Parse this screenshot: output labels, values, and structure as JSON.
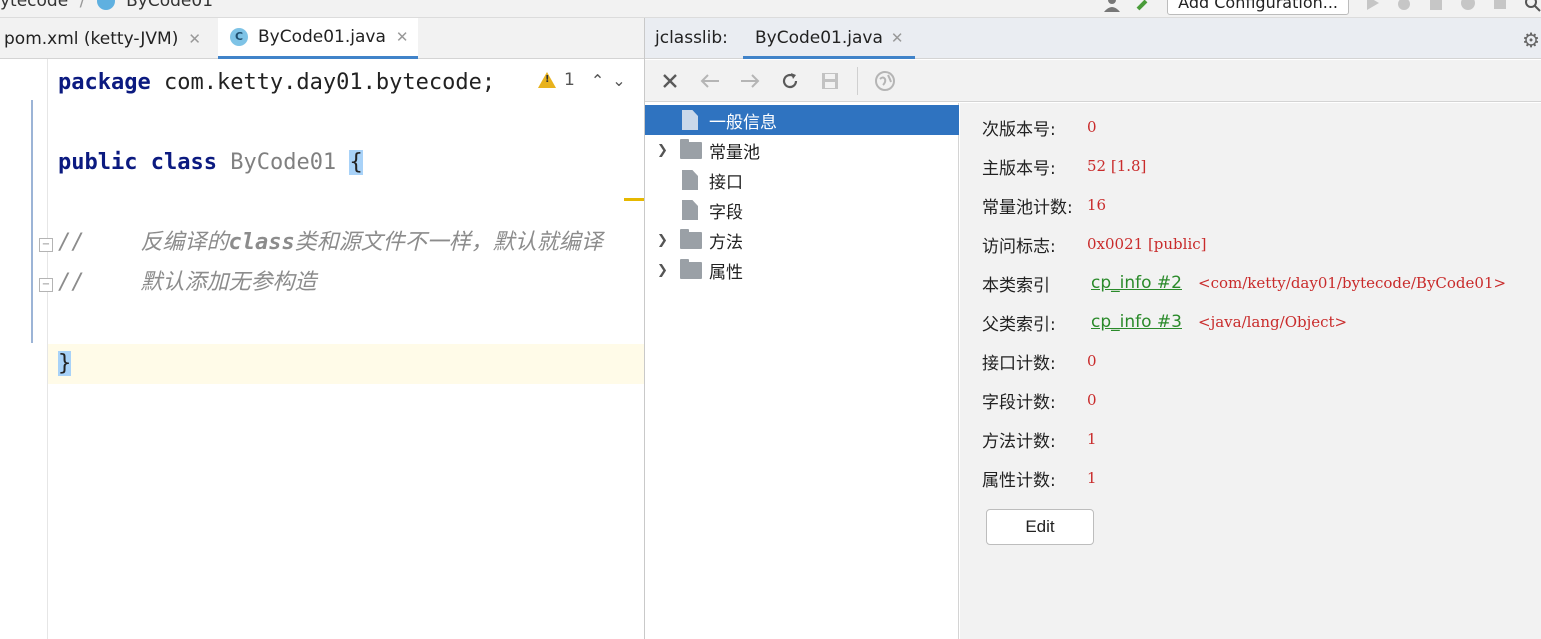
{
  "topbar": {
    "breadcrumb_left": "ytecode",
    "breadcrumb_right": "ByCode01",
    "add_configuration": "Add Configuration..."
  },
  "editor": {
    "tabs": [
      {
        "label": "pom.xml (ketty-JVM)",
        "active": false
      },
      {
        "label": "ByCode01.java",
        "active": true
      }
    ],
    "warning_count": "1",
    "code": {
      "package_kw": "package",
      "package_name": "com.ketty.day01.bytecode;",
      "public_kw": "public",
      "class_kw": "class",
      "class_name": "ByCode01",
      "open_brace": "{",
      "comment1_slashes": "//",
      "comment1_text_a": "反编译的",
      "comment1_text_b": "class",
      "comment1_text_c": "类和源文件不一样，默认就编译",
      "comment2_slashes": "//",
      "comment2_text": "默认添加无参构造",
      "close_brace": "}"
    }
  },
  "jclasslib": {
    "title": "jclasslib:",
    "tab": "ByCode01.java",
    "toolbar": [
      "close-icon",
      "back-icon",
      "forward-icon",
      "refresh-icon",
      "save-icon",
      "browser-icon"
    ],
    "tree": [
      {
        "label": "一般信息",
        "type": "file",
        "expandable": false,
        "selected": true
      },
      {
        "label": "常量池",
        "type": "folder",
        "expandable": true,
        "selected": false
      },
      {
        "label": "接口",
        "type": "file",
        "expandable": false,
        "selected": false
      },
      {
        "label": "字段",
        "type": "file",
        "expandable": false,
        "selected": false
      },
      {
        "label": "方法",
        "type": "folder",
        "expandable": true,
        "selected": false
      },
      {
        "label": "属性",
        "type": "folder",
        "expandable": true,
        "selected": false
      }
    ],
    "details": [
      {
        "label": "次版本号:",
        "value": "0"
      },
      {
        "label": "主版本号:",
        "value": "52 [1.8]"
      },
      {
        "label": "常量池计数:",
        "value": "16"
      },
      {
        "label": "访问标志:",
        "value": "0x0021 [public]"
      },
      {
        "label": "本类索引",
        "link": "cp_info #2",
        "ref": "<com/ketty/day01/bytecode/ByCode01>"
      },
      {
        "label": "父类索引:",
        "link": "cp_info #3",
        "ref": "<java/lang/Object>"
      },
      {
        "label": "接口计数:",
        "value": "0"
      },
      {
        "label": "字段计数:",
        "value": "0"
      },
      {
        "label": "方法计数:",
        "value": "1"
      },
      {
        "label": "属性计数:",
        "value": "1"
      }
    ],
    "edit_button": "Edit"
  },
  "colors": {
    "accent": "#4083c9",
    "selection": "#2f73c0",
    "value_red": "#c92b2b",
    "link_green": "#2a8a2a",
    "keyword": "#0b1a80"
  }
}
